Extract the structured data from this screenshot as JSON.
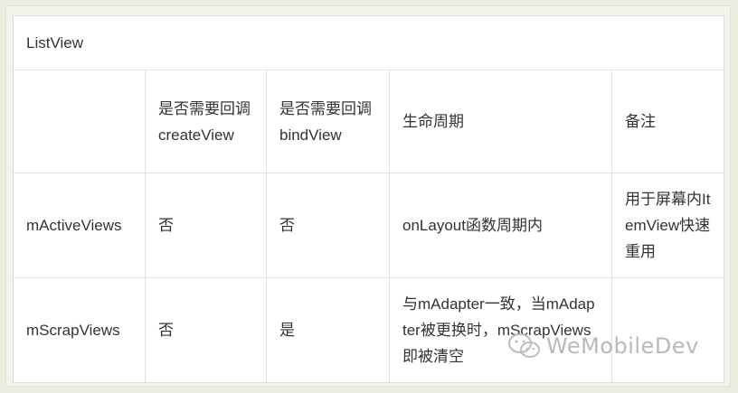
{
  "table": {
    "title": "ListView",
    "headers": [
      "",
      "是否需要回调createView",
      "是否需要回调bindView",
      "生命周期",
      "备注"
    ],
    "rows": [
      [
        "mActiveViews",
        "否",
        "否",
        "onLayout函数周期内",
        "用于屏幕内ItemView快速重用"
      ],
      [
        "mScrapViews",
        "否",
        "是",
        "与mAdapter一致，当mAdapter被更换时，mScrapViews即被清空",
        ""
      ]
    ]
  },
  "watermark": {
    "text": "WeMobileDev",
    "icon": "wechat-icon"
  }
}
